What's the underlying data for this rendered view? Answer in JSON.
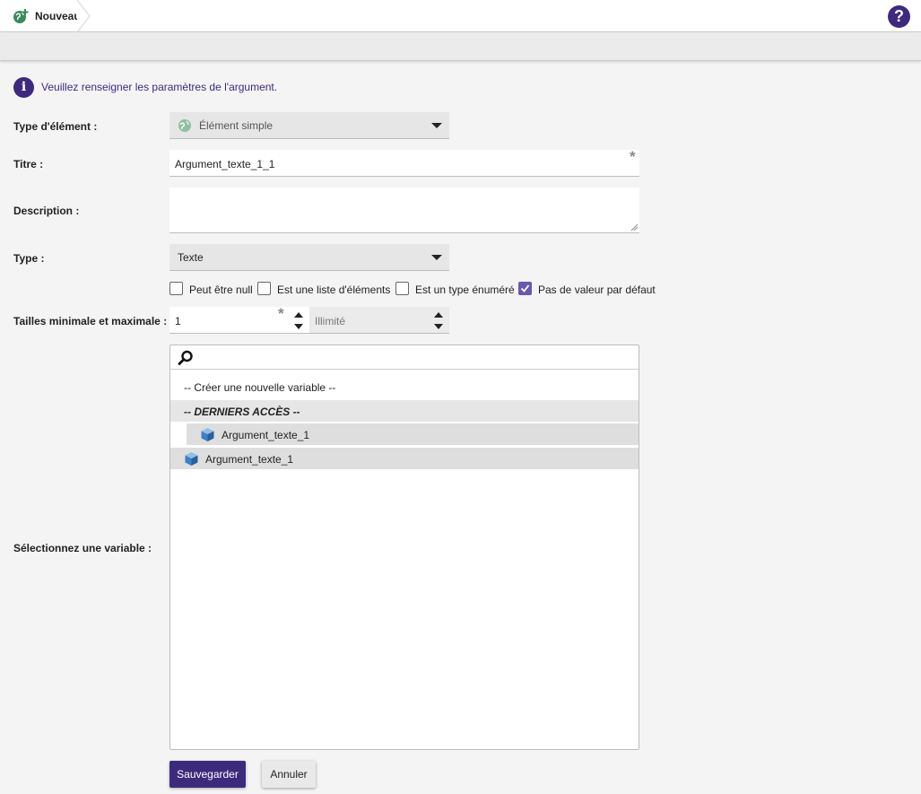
{
  "breadcrumb": {
    "label": "Nouveau"
  },
  "help": {
    "glyph": "?"
  },
  "info": {
    "glyph": "i",
    "message": "Veuillez renseigner les paramètres de l'argument."
  },
  "form": {
    "element_type": {
      "label": "Type d'élément :",
      "value": "Élément simple"
    },
    "title": {
      "label": "Titre :",
      "value": "Argument_texte_1_1",
      "required": "*"
    },
    "description": {
      "label": "Description :",
      "value": ""
    },
    "type": {
      "label": "Type :",
      "value": "Texte"
    },
    "options": [
      {
        "label": "Peut être null",
        "checked": false
      },
      {
        "label": "Est une liste d'éléments",
        "checked": false
      },
      {
        "label": "Est un type énuméré",
        "checked": false
      },
      {
        "label": "Pas de valeur par défaut",
        "checked": true
      }
    ],
    "sizes": {
      "label": "Tailles minimale et maximale :",
      "min_value": "1",
      "min_required": "*",
      "max_placeholder": "Illimité"
    },
    "variable": {
      "label": "Sélectionnez une variable :",
      "search_value": "",
      "create_label": "-- Créer une nouvelle variable --",
      "recent_header": "-- DERNIERS ACCÈS --",
      "recent_items": [
        "Argument_texte_1"
      ],
      "items": [
        "Argument_texte_1"
      ]
    }
  },
  "actions": {
    "save": "Sauvegarder",
    "cancel": "Annuler"
  },
  "colors": {
    "primary": "#3e2a7d",
    "checkbox_checked": "#6a58a8",
    "cube": "#3f7fc4"
  }
}
